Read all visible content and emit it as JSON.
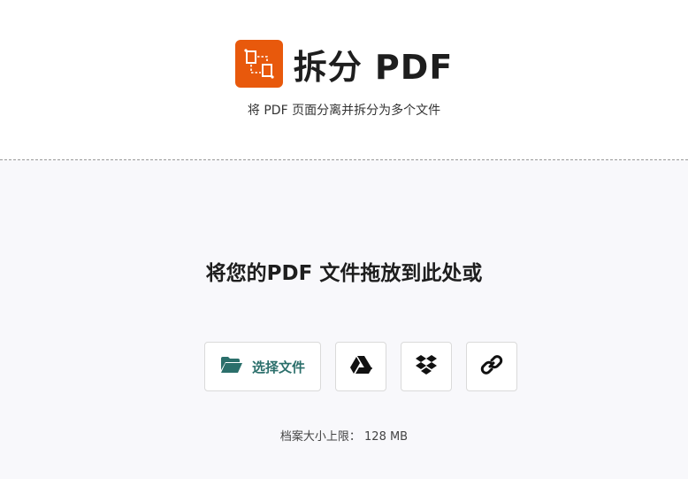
{
  "header": {
    "logo_icon": "split-pages-icon",
    "title": "拆分 PDF",
    "subtitle": "将 PDF 页面分离并拆分为多个文件",
    "brand_color": "#e8590c"
  },
  "upload": {
    "heading": "将您的PDF 文件拖放到此处或",
    "choose_file_label": "选择文件",
    "choose_file_icon": "folder-open-icon",
    "google_drive_icon": "google-drive-icon",
    "dropbox_icon": "dropbox-icon",
    "url_icon": "link-icon",
    "accent_color": "#2b6f6b",
    "file_limit": "档案大小上限：  128 MB"
  }
}
